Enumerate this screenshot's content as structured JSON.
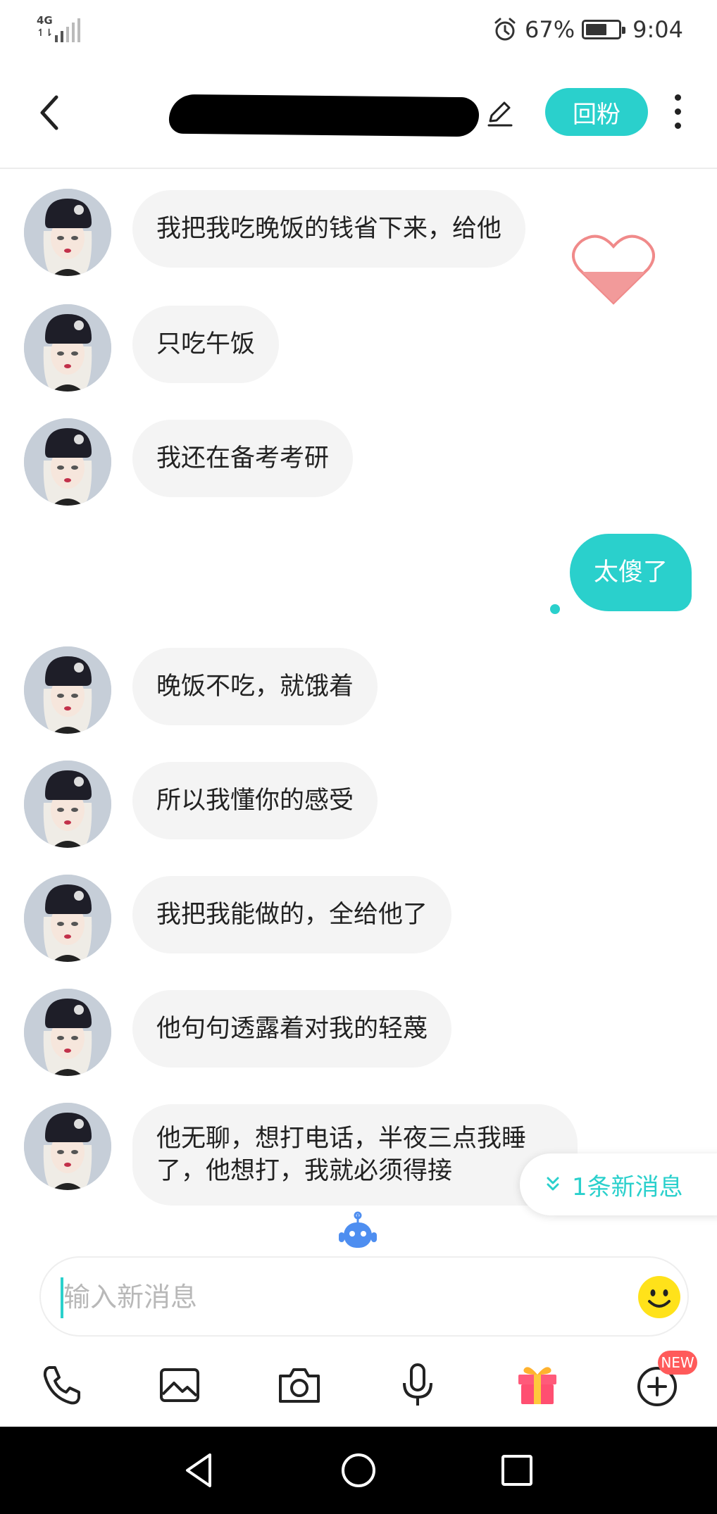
{
  "status_bar": {
    "network": "4G",
    "battery_percent": "67%",
    "battery_level": 0.67,
    "time": "9:04"
  },
  "header": {
    "name_visible_suffix": "",
    "follow_back_label": "回粉"
  },
  "messages": [
    {
      "from": "other",
      "text": "我把我吃晚饭的钱省下来，给他"
    },
    {
      "from": "other",
      "text": "只吃午饭"
    },
    {
      "from": "other",
      "text": "我还在备考考研"
    },
    {
      "from": "me",
      "text": "太傻了"
    },
    {
      "from": "other",
      "text": "晚饭不吃，就饿着"
    },
    {
      "from": "other",
      "text": "所以我懂你的感受"
    },
    {
      "from": "other",
      "text": "我把我能做的，全给他了"
    },
    {
      "from": "other",
      "text": "他句句透露着对我的轻蔑"
    },
    {
      "from": "other",
      "text": "他无聊，想打电话，半夜三点我睡了，他想打，我就必须得接"
    }
  ],
  "new_message_pill": "1条新消息",
  "input": {
    "placeholder": "输入新消息",
    "value": ""
  },
  "toolbar": {
    "items": [
      "phone-icon",
      "image-icon",
      "camera-icon",
      "microphone-icon",
      "gift-icon",
      "plus-icon"
    ],
    "new_badge": "NEW"
  },
  "colors": {
    "accent": "#2ad0cc",
    "bubble_other": "#f4f4f4",
    "badge": "#ff5a5a"
  }
}
